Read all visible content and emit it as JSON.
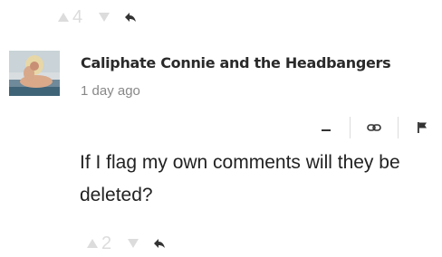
{
  "top_votes": {
    "up_count": "4"
  },
  "comment": {
    "author": "Caliphate Connie and the Headbangers",
    "timestamp": "1 day ago",
    "text": "If I flag my own comments will they be deleted?",
    "actions": [
      "collapse",
      "link",
      "flag"
    ]
  },
  "bottom_votes": {
    "up_count": "2"
  },
  "colors": {
    "muted": "#dcdcdc",
    "text": "#222222",
    "meta": "#888888"
  }
}
